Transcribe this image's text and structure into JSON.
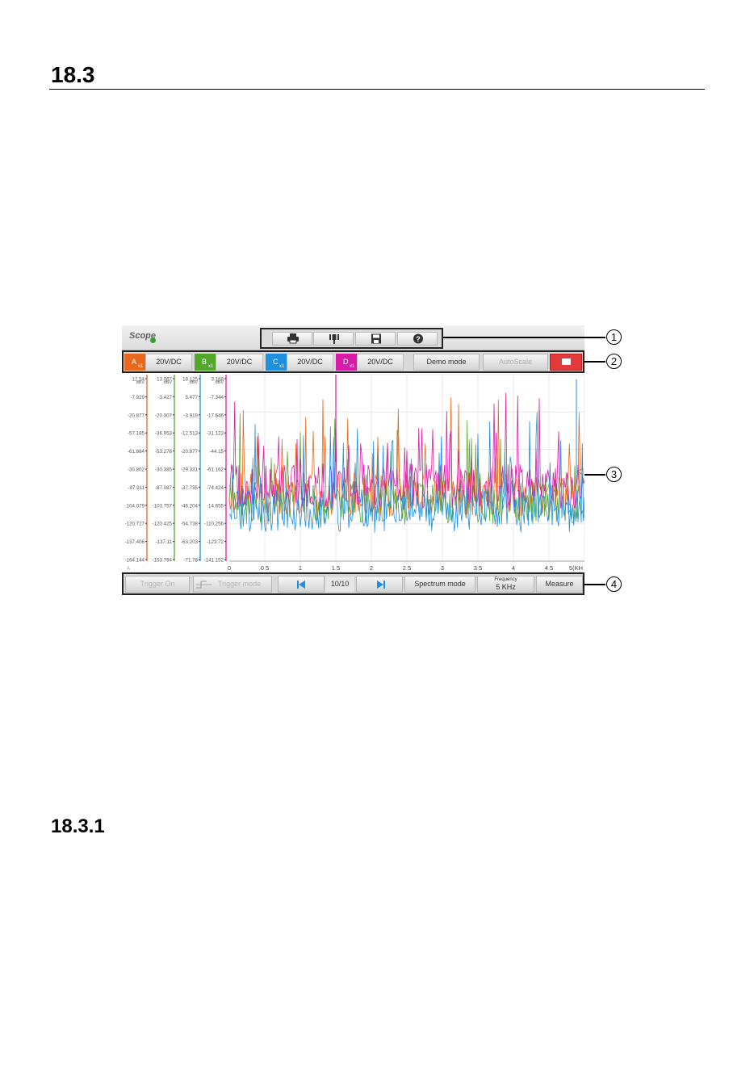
{
  "section": {
    "number": "18.3"
  },
  "subsection": {
    "number": "18.3.1"
  },
  "screenshot": {
    "app_title": "Scope",
    "toolbar": {
      "icons": [
        "printer-icon",
        "marker-icon",
        "save-icon",
        "help-icon"
      ]
    },
    "channels": [
      {
        "letter": "A",
        "probe": "x1",
        "scale": "20V/DC",
        "color": "#e8691d"
      },
      {
        "letter": "B",
        "probe": "x1",
        "scale": "20V/DC",
        "color": "#52a829"
      },
      {
        "letter": "C",
        "probe": "x1",
        "scale": "20V/DC",
        "color": "#1f8fe0"
      },
      {
        "letter": "D",
        "probe": "x1",
        "scale": "20V/DC",
        "color": "#d81ca8"
      }
    ],
    "buttons": {
      "demo_mode": "Demo mode",
      "autoscale": "AutoScale"
    },
    "bottom": {
      "trigger_on": "Trigger On",
      "trigger_mode": "Trigger mode",
      "page": "10/10",
      "spectrum_mode": "Spectrum mode",
      "frequency_label": "Frequency",
      "frequency_value": "5 KHz",
      "measure": "Measure"
    },
    "spectrum": {
      "x_ticks": [
        "0",
        "0.5",
        "1",
        "1.5",
        "2",
        "2.5",
        "3",
        "3.5",
        "4",
        "4.5",
        "5(KH"
      ],
      "y_ticks": {
        "A": [
          "12.54",
          "-7.929",
          "-20.877",
          "-57.185",
          "-61.884",
          "-30.802",
          "-97.911",
          "-104.079",
          "-120.727",
          "-137.406",
          "-164.144"
        ],
        "B": [
          "13.067",
          "-3.427",
          "-20.307",
          "-36.953",
          "-53.278",
          "-30.385",
          "-87.087",
          "-103.757",
          "-120.425",
          "-137.11",
          "-153.794"
        ],
        "C": [
          "18.125",
          "5.477",
          "-3.919",
          "-12.513",
          "-20.877",
          "-29.331",
          "-37.735",
          "-46.204",
          "-54.738",
          "-63.203",
          "-71.78"
        ],
        "D": [
          "3.168",
          "-7.344",
          "-17.646",
          "-31.123",
          "-44.15",
          "-61.162",
          "-74.424",
          "-14.655",
          "-110.256",
          "-123.72",
          "-141.152"
        ]
      },
      "unit": "dBV"
    },
    "callouts": [
      "1",
      "2",
      "3",
      "4"
    ]
  }
}
